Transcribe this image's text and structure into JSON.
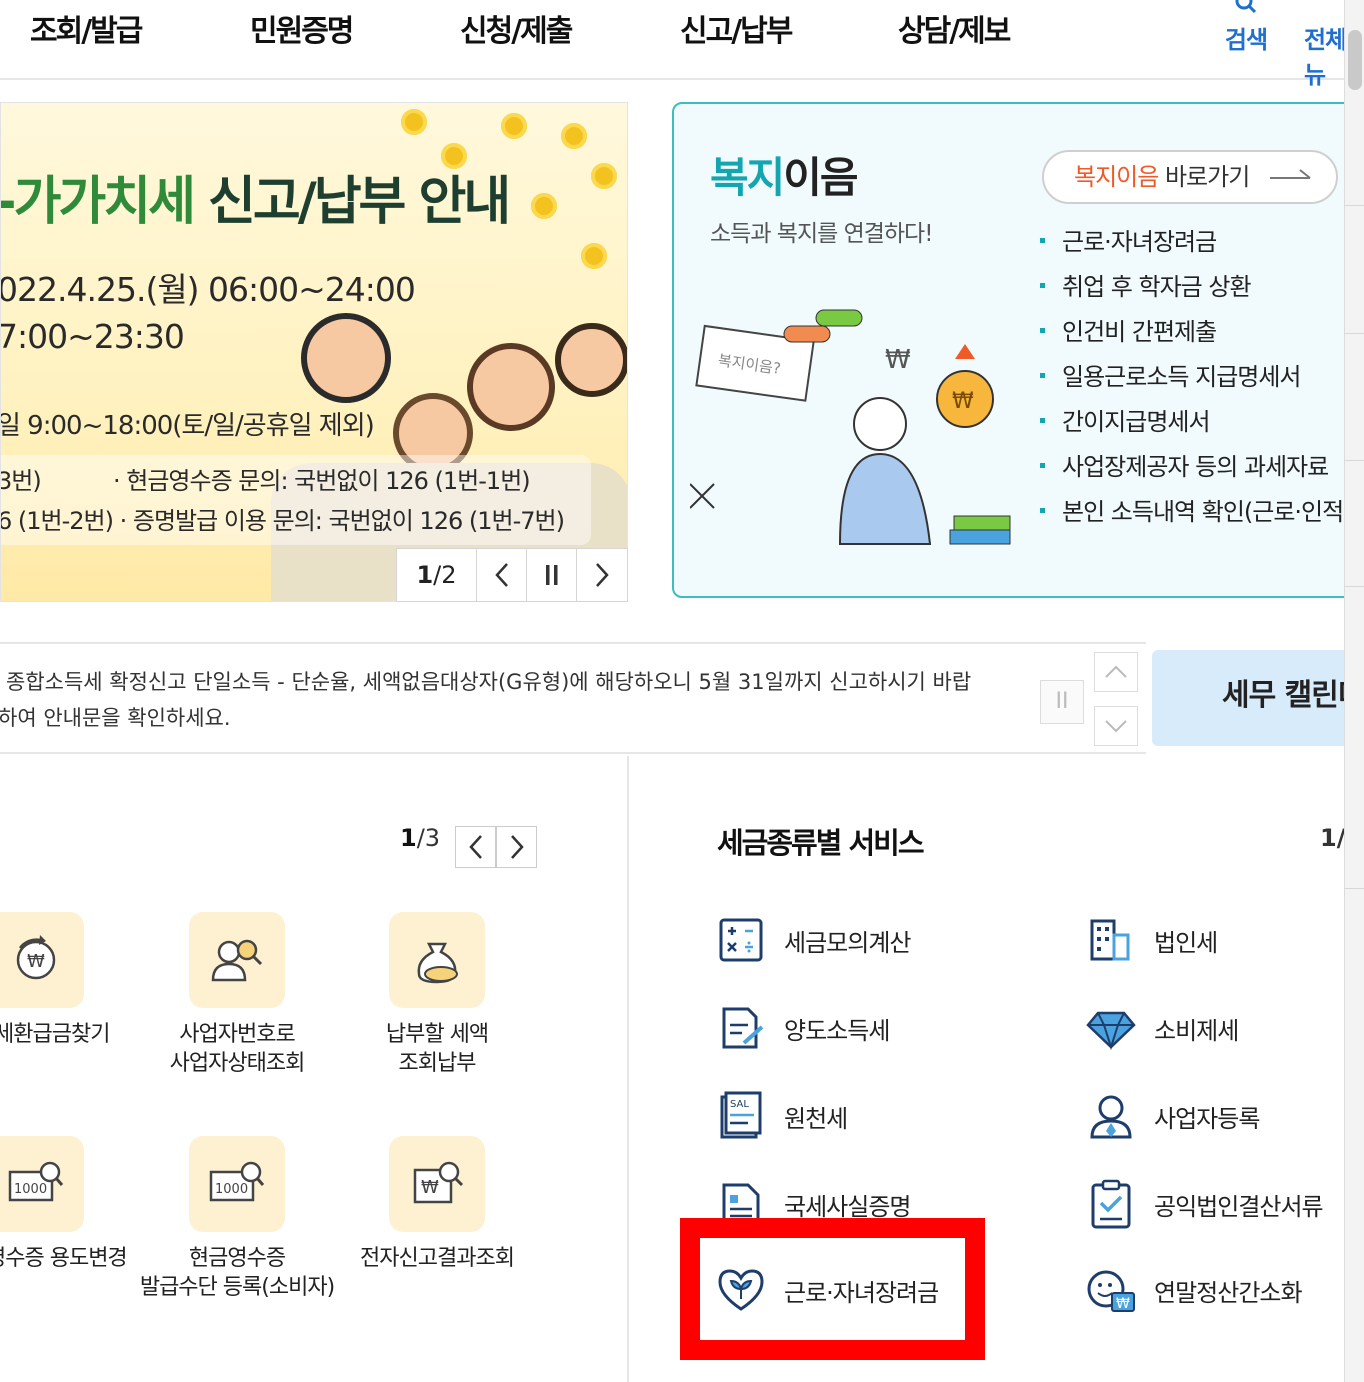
{
  "nav": {
    "items": [
      "조회/발급",
      "민원증명",
      "신청/제출",
      "신고/납부",
      "상담/제보"
    ],
    "search_label": "검색",
    "all_menu_label": "전체메뉴"
  },
  "banner": {
    "title_part1": "-가가치세 ",
    "title_part2": "신고/납부 안내",
    "line1": "022.4.25.(월) 06:00~24:00",
    "line2": "7:00~23:30",
    "line3": "일 9:00~18:00(토/일/공휴일 제외)",
    "info1_left": "3번)",
    "info1_right": "· 현금영수증 문의: 국번없이 126 (1번-1번)",
    "info2": "6 (1번-2번) · 증명발급 이용 문의: 국번없이 126 (1번-7번)",
    "page_current": "1",
    "page_sep_total": "/2",
    "prev_label": "<",
    "pause_label": "II",
    "next_label": ">"
  },
  "welfare": {
    "title_accent": "복지",
    "title_rest": "이음",
    "subtitle": "소득과 복지를 연결하다!",
    "link_accent": "복지이음",
    "link_rest": " 바로가기",
    "illustration_sign": "복지이음?",
    "list": [
      "근로·자녀장려금",
      "취업 후 학자금 상환",
      "인건비 간편제출",
      "일용근로소득 지급명세서",
      "간이지급명세서",
      "사업장제공자 등의 과세자료",
      "본인 소득내역 확인(근로·인적용역)"
    ]
  },
  "notice": {
    "line1": "종합소득세 확정신고 단일소득 - 단순율, 세액없음대상자(G유형)에 해당하오니 5월 31일까지 신고하시기 바랍",
    "line2": "하여 안내문을 확인하세요.",
    "pause_label": "II",
    "calendar_label": "세무 캘린더"
  },
  "quick": {
    "page_current": "1",
    "page_total": "/3",
    "items": [
      {
        "label": "세환급금찾기",
        "icon": "refund-icon"
      },
      {
        "label": "사업자번호로\n사업자상태조회",
        "icon": "business-search-icon"
      },
      {
        "label": "납부할 세액\n조회납부",
        "icon": "money-bag-icon"
      },
      {
        "label": "영수증 용도변경",
        "icon": "receipt-search-icon"
      },
      {
        "label": "현금영수증\n발급수단 등록(소비자)",
        "icon": "card-search-icon"
      },
      {
        "label": "전자신고결과조회",
        "icon": "won-search-icon"
      }
    ]
  },
  "tax_services": {
    "title": "세금종류별 서비스",
    "page_indicator": "1/",
    "items": [
      {
        "label": "세금모의계산",
        "icon": "calculator-icon"
      },
      {
        "label": "법인세",
        "icon": "building-icon"
      },
      {
        "label": "양도소득세",
        "icon": "document-edit-icon"
      },
      {
        "label": "소비제세",
        "icon": "diamond-icon"
      },
      {
        "label": "원천세",
        "icon": "salary-slip-icon"
      },
      {
        "label": "사업자등록",
        "icon": "person-icon"
      },
      {
        "label": "국세사실증명",
        "icon": "certificate-icon"
      },
      {
        "label": "공익법인결산서류",
        "icon": "clipboard-check-icon"
      },
      {
        "label": "근로·자녀장려금",
        "icon": "heart-sprout-icon"
      },
      {
        "label": "연말정산간소화",
        "icon": "face-won-icon"
      }
    ]
  },
  "colors": {
    "accent_teal": "#14a6b0",
    "link_orange": "#f05a28",
    "nav_blue": "#1f6fd0",
    "highlight_red": "#ff0000",
    "tile_bg": "#fdf1d2"
  }
}
